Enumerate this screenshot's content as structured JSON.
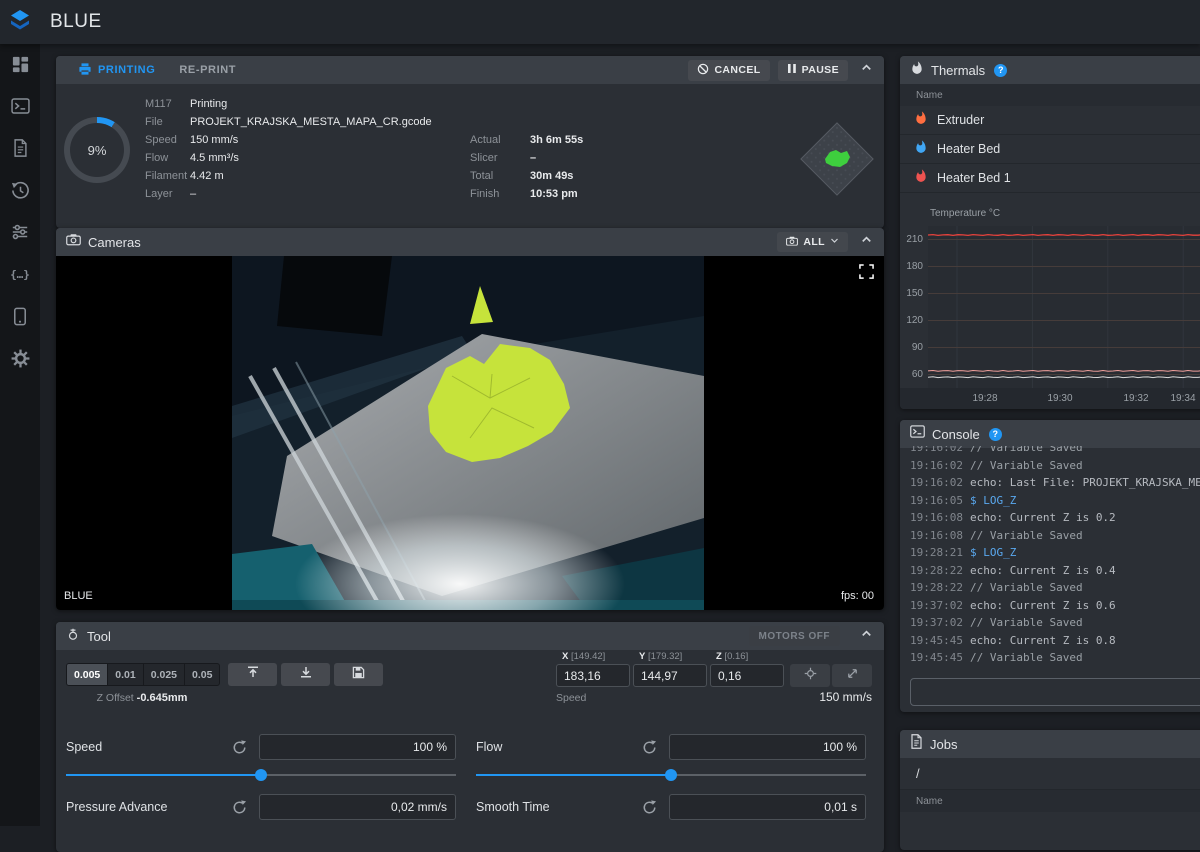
{
  "app": {
    "title": "BLUE",
    "logo_icon": "layers-icon"
  },
  "sidebar": {
    "items": [
      {
        "name": "dashboard"
      },
      {
        "name": "console"
      },
      {
        "name": "gcode-files"
      },
      {
        "name": "history"
      },
      {
        "name": "tune"
      },
      {
        "name": "macros"
      },
      {
        "name": "machine"
      },
      {
        "name": "settings"
      }
    ]
  },
  "printing_panel": {
    "tab_printing": "PRINTING",
    "tab_reprint": "RE-PRINT",
    "cancel_label": "CANCEL",
    "pause_label": "PAUSE",
    "progress_text": "9%",
    "progress_pct": 9,
    "accent_color": "#2196f3",
    "fields_left": [
      {
        "label": "M117",
        "value": "Printing"
      },
      {
        "label": "File",
        "value": "PROJEKT_KRAJSKA_MESTA_MAPA_CR.gcode"
      },
      {
        "label": "Speed",
        "value": "150 mm/s"
      },
      {
        "label": "Flow",
        "value": "4.5 mm³/s"
      },
      {
        "label": "Filament",
        "value": "4.42 m"
      },
      {
        "label": "Layer",
        "value": "–"
      }
    ],
    "fields_right": [
      {
        "label": "Actual",
        "value": "3h 6m 55s"
      },
      {
        "label": "Slicer",
        "value": "–"
      },
      {
        "label": "Total",
        "value": "30m 49s"
      },
      {
        "label": "Finish",
        "value": "10:53 pm"
      }
    ]
  },
  "cameras_panel": {
    "title": "Cameras",
    "all_button": "ALL",
    "overlay_name": "BLUE",
    "overlay_fps": "fps: 00"
  },
  "tool_panel": {
    "title": "Tool",
    "motors_off": "MOTORS OFF",
    "z_steps": [
      "0.005",
      "0.01",
      "0.025",
      "0.05"
    ],
    "z_offset_label": "Z Offset",
    "z_offset_value": "-0.645mm",
    "axes": [
      {
        "label": "X",
        "limit": "[149.42]",
        "value": "183,16"
      },
      {
        "label": "Y",
        "limit": "[179.32]",
        "value": "144,97"
      },
      {
        "label": "Z",
        "limit": "[0.16]",
        "value": "0,16"
      }
    ],
    "speed_label": "Speed",
    "speed_value": "150 mm/s",
    "sliders": [
      {
        "label": "Speed",
        "value": "100 %",
        "pct": 50
      },
      {
        "label": "Flow",
        "value": "100 %",
        "pct": 50
      },
      {
        "label": "Pressure Advance",
        "value": "0,02 mm/s"
      },
      {
        "label": "Smooth Time",
        "value": "0,01 s"
      }
    ]
  },
  "thermals_panel": {
    "title": "Thermals",
    "help": "?",
    "name_header": "Name",
    "sensors": [
      {
        "name": "Extruder",
        "color": "#ff6e40"
      },
      {
        "name": "Heater Bed",
        "color": "#40a6f4"
      },
      {
        "name": "Heater Bed 1",
        "color": "#ef5350"
      }
    ]
  },
  "chart_data": {
    "type": "line",
    "title": "Temperature °C",
    "x_ticks": [
      "19:28",
      "19:30",
      "19:32",
      "19:34"
    ],
    "y_ticks": [
      210,
      180,
      150,
      120,
      90,
      60
    ],
    "ylim": [
      45,
      225
    ],
    "grid": true,
    "legend_position": "none",
    "series": [
      {
        "name": "Extruder",
        "color": "#e8423c",
        "approx_value": 215,
        "width": 1.3
      },
      {
        "name": "Heater Bed 1",
        "color": "#f2a09c",
        "approx_value": 64,
        "width": 1
      },
      {
        "name": "Heater Bed",
        "color": "#d9dadb",
        "approx_value": 57,
        "width": 1
      }
    ]
  },
  "console_panel": {
    "title": "Console",
    "help": "?",
    "input_value": "",
    "lines": [
      {
        "time": "19:16:02",
        "text": "// Variable Saved",
        "type": "comment"
      },
      {
        "time": "19:16:02",
        "text": "// Variable Saved",
        "type": "comment"
      },
      {
        "time": "19:16:02",
        "text": "echo: Last File: PROJEKT_KRAJSKA_MESTA_MAPA_CR.gcode",
        "type": "echo"
      },
      {
        "time": "19:16:05",
        "text": "$ LOG_Z",
        "type": "command"
      },
      {
        "time": "19:16:08",
        "text": "echo: Current Z is 0.2",
        "type": "echo"
      },
      {
        "time": "19:16:08",
        "text": "// Variable Saved",
        "type": "comment"
      },
      {
        "time": "19:28:21",
        "text": "$ LOG_Z",
        "type": "command"
      },
      {
        "time": "19:28:22",
        "text": "echo: Current Z is 0.4",
        "type": "echo"
      },
      {
        "time": "19:28:22",
        "text": "// Variable Saved",
        "type": "comment"
      },
      {
        "time": "19:37:02",
        "text": "echo: Current Z is 0.6",
        "type": "echo"
      },
      {
        "time": "19:37:02",
        "text": "// Variable Saved",
        "type": "comment"
      },
      {
        "time": "19:45:45",
        "text": "echo: Current Z is 0.8",
        "type": "echo"
      },
      {
        "time": "19:45:45",
        "text": "// Variable Saved",
        "type": "comment"
      }
    ]
  },
  "jobs_panel": {
    "title": "Jobs",
    "path": "/",
    "name_header": "Name"
  }
}
